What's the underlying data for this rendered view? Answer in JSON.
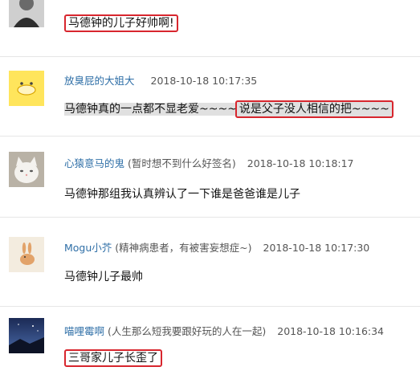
{
  "comments": [
    {
      "username": "",
      "signature": "",
      "timestamp": "",
      "content": "马德钟的儿子好帅啊!",
      "avatar_icon": "man-portrait-avatar"
    },
    {
      "username": "放臭屁的大姐大",
      "signature": "",
      "timestamp": "2018-10-18 10:17:35",
      "content_part1": "马德钟真的一点都不显老爱~~~~",
      "content_part2": "说是父子没人相信的把~~~~",
      "avatar_icon": "yellow-cartoon-avatar"
    },
    {
      "username": "心猿意马的鬼",
      "signature": "(暂时想不到什么好签名)",
      "timestamp": "2018-10-18 10:18:17",
      "content": "马德钟那组我认真辨认了一下谁是爸爸谁是儿子",
      "avatar_icon": "white-cat-avatar"
    },
    {
      "username": "Mogu小芥",
      "signature": "(精神病患者，有被害妄想症~)",
      "timestamp": "2018-10-18 10:17:30",
      "content": "马德钟儿子最帅",
      "avatar_icon": "rabbit-drawing-avatar"
    },
    {
      "username": "喵哩霉啊",
      "signature": "(人生那么短我要跟好玩的人在一起)",
      "timestamp": "2018-10-18 10:16:34",
      "content": "三哥家儿子长歪了",
      "avatar_icon": "night-sky-avatar"
    }
  ],
  "colors": {
    "username": "#2f6fa7",
    "highlight_border": "#d8262e",
    "divider": "#e6e6e6"
  }
}
